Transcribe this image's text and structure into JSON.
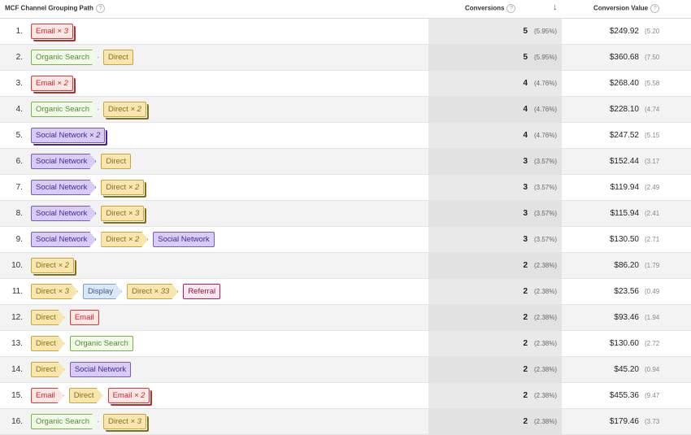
{
  "header": {
    "path_label": "MCF Channel Grouping Path",
    "conversions_label": "Conversions",
    "value_label": "Conversion Value",
    "help_glyph": "?",
    "sort_glyph": "↓"
  },
  "colors": {
    "email": "#c62828",
    "organic_search": "#558b2f",
    "direct": "#8a6d1b",
    "social_network": "#4527a0",
    "display": "#3c5a86",
    "referral": "#8e1846"
  },
  "rows": [
    {
      "num": "1.",
      "path": [
        {
          "name": "Email",
          "mult": "× 3",
          "type": "email"
        }
      ],
      "conv": "5",
      "pct": "(5.95%)",
      "value": "$249.92",
      "vpct": "(5.20"
    },
    {
      "num": "2.",
      "path": [
        {
          "name": "Organic Search",
          "mult": "",
          "type": "organic"
        },
        {
          "name": "Direct",
          "mult": "",
          "type": "direct"
        }
      ],
      "conv": "5",
      "pct": "(5.95%)",
      "value": "$360.68",
      "vpct": "(7.50"
    },
    {
      "num": "3.",
      "path": [
        {
          "name": "Email",
          "mult": "× 2",
          "type": "email"
        }
      ],
      "conv": "4",
      "pct": "(4.76%)",
      "value": "$268.40",
      "vpct": "(5.58"
    },
    {
      "num": "4.",
      "path": [
        {
          "name": "Organic Search",
          "mult": "",
          "type": "organic"
        },
        {
          "name": "Direct",
          "mult": "× 2",
          "type": "direct"
        }
      ],
      "conv": "4",
      "pct": "(4.76%)",
      "value": "$228.10",
      "vpct": "(4.74"
    },
    {
      "num": "5.",
      "path": [
        {
          "name": "Social Network",
          "mult": "× 2",
          "type": "social"
        }
      ],
      "conv": "4",
      "pct": "(4.76%)",
      "value": "$247.52",
      "vpct": "(5.15"
    },
    {
      "num": "6.",
      "path": [
        {
          "name": "Social Network",
          "mult": "",
          "type": "social"
        },
        {
          "name": "Direct",
          "mult": "",
          "type": "direct"
        }
      ],
      "conv": "3",
      "pct": "(3.57%)",
      "value": "$152.44",
      "vpct": "(3.17"
    },
    {
      "num": "7.",
      "path": [
        {
          "name": "Social Network",
          "mult": "",
          "type": "social"
        },
        {
          "name": "Direct",
          "mult": "× 2",
          "type": "direct"
        }
      ],
      "conv": "3",
      "pct": "(3.57%)",
      "value": "$119.94",
      "vpct": "(2.49"
    },
    {
      "num": "8.",
      "path": [
        {
          "name": "Social Network",
          "mult": "",
          "type": "social"
        },
        {
          "name": "Direct",
          "mult": "× 3",
          "type": "direct"
        }
      ],
      "conv": "3",
      "pct": "(3.57%)",
      "value": "$115.94",
      "vpct": "(2.41"
    },
    {
      "num": "9.",
      "path": [
        {
          "name": "Social Network",
          "mult": "",
          "type": "social"
        },
        {
          "name": "Direct",
          "mult": "× 2",
          "type": "direct"
        },
        {
          "name": "Social Network",
          "mult": "",
          "type": "social"
        }
      ],
      "conv": "3",
      "pct": "(3.57%)",
      "value": "$130.50",
      "vpct": "(2.71"
    },
    {
      "num": "10.",
      "path": [
        {
          "name": "Direct",
          "mult": "× 2",
          "type": "direct"
        }
      ],
      "conv": "2",
      "pct": "(2.38%)",
      "value": "$86.20",
      "vpct": "(1.79"
    },
    {
      "num": "11.",
      "path": [
        {
          "name": "Direct",
          "mult": "× 3",
          "type": "direct"
        },
        {
          "name": "Display",
          "mult": "",
          "type": "display"
        },
        {
          "name": "Direct",
          "mult": "× 33",
          "type": "direct"
        },
        {
          "name": "Referral",
          "mult": "",
          "type": "referral"
        }
      ],
      "conv": "2",
      "pct": "(2.38%)",
      "value": "$23.56",
      "vpct": "(0.49"
    },
    {
      "num": "12.",
      "path": [
        {
          "name": "Direct",
          "mult": "",
          "type": "direct"
        },
        {
          "name": "Email",
          "mult": "",
          "type": "email"
        }
      ],
      "conv": "2",
      "pct": "(2.38%)",
      "value": "$93.46",
      "vpct": "(1.94"
    },
    {
      "num": "13.",
      "path": [
        {
          "name": "Direct",
          "mult": "",
          "type": "direct"
        },
        {
          "name": "Organic Search",
          "mult": "",
          "type": "organic"
        }
      ],
      "conv": "2",
      "pct": "(2.38%)",
      "value": "$130.60",
      "vpct": "(2.72"
    },
    {
      "num": "14.",
      "path": [
        {
          "name": "Direct",
          "mult": "",
          "type": "direct"
        },
        {
          "name": "Social Network",
          "mult": "",
          "type": "social"
        }
      ],
      "conv": "2",
      "pct": "(2.38%)",
      "value": "$45.20",
      "vpct": "(0.94"
    },
    {
      "num": "15.",
      "path": [
        {
          "name": "Email",
          "mult": "",
          "type": "email"
        },
        {
          "name": "Direct",
          "mult": "",
          "type": "direct"
        },
        {
          "name": "Email",
          "mult": "× 2",
          "type": "email"
        }
      ],
      "conv": "2",
      "pct": "(2.38%)",
      "value": "$455.36",
      "vpct": "(9.47"
    },
    {
      "num": "16.",
      "path": [
        {
          "name": "Organic Search",
          "mult": "",
          "type": "organic"
        },
        {
          "name": "Direct",
          "mult": "× 3",
          "type": "direct"
        }
      ],
      "conv": "2",
      "pct": "(2.38%)",
      "value": "$179.46",
      "vpct": "(3.73"
    }
  ]
}
